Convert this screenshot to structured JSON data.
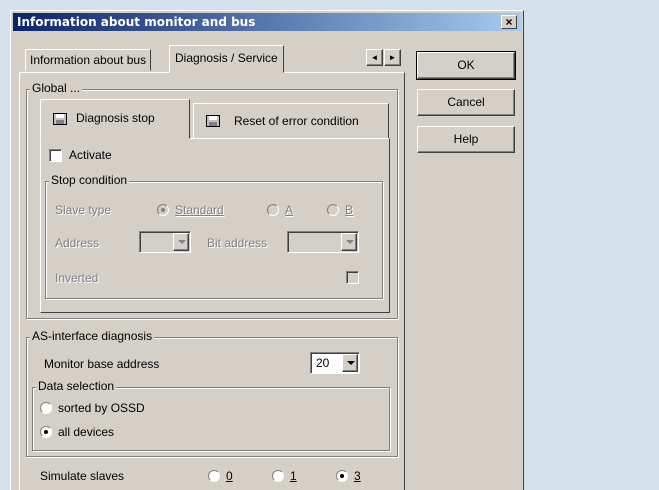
{
  "window": {
    "title": "Information about monitor and bus",
    "close_glyph": "×"
  },
  "tabs": [
    {
      "label": "Information about bus",
      "active": false
    },
    {
      "label": "Diagnosis / Service",
      "active": true
    }
  ],
  "tab_scroll": {
    "left": "◄",
    "right": "►"
  },
  "buttons": {
    "ok": "OK",
    "cancel": "Cancel",
    "help": "Help"
  },
  "global": {
    "label": "Global ...",
    "subtabs": [
      {
        "label": "Diagnosis stop",
        "icon": "disk-icon"
      },
      {
        "label": "Reset of error condition",
        "icon": "disk-icon"
      }
    ],
    "activate": {
      "label": "Activate",
      "checked": false
    },
    "stop_condition": {
      "label": "Stop condition",
      "slave_type_label": "Slave type",
      "slave_types": [
        {
          "label": "Standard",
          "selected": true
        },
        {
          "label": "A",
          "selected": false
        },
        {
          "label": "B",
          "selected": false
        }
      ],
      "address_label": "Address",
      "address_value": "",
      "bit_address_label": "Bit address",
      "bit_address_value": "",
      "inverted_label": "Inverted",
      "inverted_checked": false
    }
  },
  "as_interface": {
    "label": "AS-interface diagnosis",
    "monitor_base_label": "Monitor base address",
    "monitor_base_value": "20",
    "data_selection": {
      "label": "Data selection",
      "options": [
        {
          "label": "sorted by OSSD",
          "selected": false
        },
        {
          "label": "all devices",
          "selected": true
        }
      ]
    }
  },
  "simulate": {
    "label": "Simulate slaves",
    "options": [
      {
        "label": "0",
        "selected": false
      },
      {
        "label": "1",
        "selected": false
      },
      {
        "label": "3",
        "selected": true
      }
    ]
  }
}
